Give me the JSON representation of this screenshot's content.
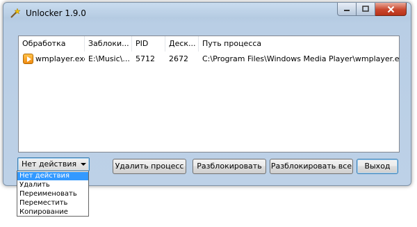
{
  "window": {
    "title": "Unlocker 1.9.0"
  },
  "table": {
    "columns": [
      "Обработка",
      "Заблоки...",
      "PID",
      "Деск...",
      "Путь процесса"
    ],
    "rows": [
      {
        "process": "wmplayer.exe",
        "locked": "E:\\Music\\...",
        "pid": "5712",
        "desk": "2672",
        "path": "C:\\Program Files\\Windows Media Player\\wmplayer.exe",
        "icon": "media-player-icon"
      }
    ]
  },
  "action_select": {
    "value": "Нет действия",
    "options": [
      "Нет действия",
      "Удалить",
      "Переименовать",
      "Переместить",
      "Копирование"
    ]
  },
  "buttons": {
    "kill": "Удалить процесс",
    "unlock": "Разблокировать",
    "unlock_all": "Разблокировать все",
    "exit": "Выход"
  },
  "colors": {
    "selection": "#3399ff",
    "close_button": "#c9462c"
  }
}
